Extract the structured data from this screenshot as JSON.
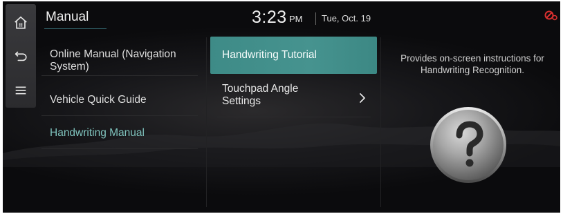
{
  "header": {
    "title": "Manual",
    "time": "3:23",
    "ampm": "PM",
    "date": "Tue, Oct. 19"
  },
  "rail": {
    "items": [
      {
        "icon": "home-icon"
      },
      {
        "icon": "back-icon"
      },
      {
        "icon": "menu-icon"
      }
    ]
  },
  "column1": {
    "items": [
      {
        "label_line1": "Online Manual (Navigation",
        "label_line2": "System)",
        "active": false
      },
      {
        "label_line1": "Vehicle Quick Guide",
        "active": false
      },
      {
        "label_line1": "Handwriting Manual",
        "active": true
      }
    ]
  },
  "column2": {
    "items": [
      {
        "label_line1": "Handwriting Tutorial",
        "selected": true
      },
      {
        "label_line1": "Touchpad Angle",
        "label_line2": "Settings",
        "has_chevron": true
      }
    ]
  },
  "description": {
    "line1": "Provides on-screen instructions for",
    "line2": "Handwriting Recognition."
  },
  "colors": {
    "accent": "#46938f",
    "active_text": "#7fc3bd",
    "status_icon": "#d9302f"
  },
  "icons": {
    "status": "unlinked-icon",
    "help": "question-mark-icon",
    "chevron": "chevron-right-icon"
  }
}
